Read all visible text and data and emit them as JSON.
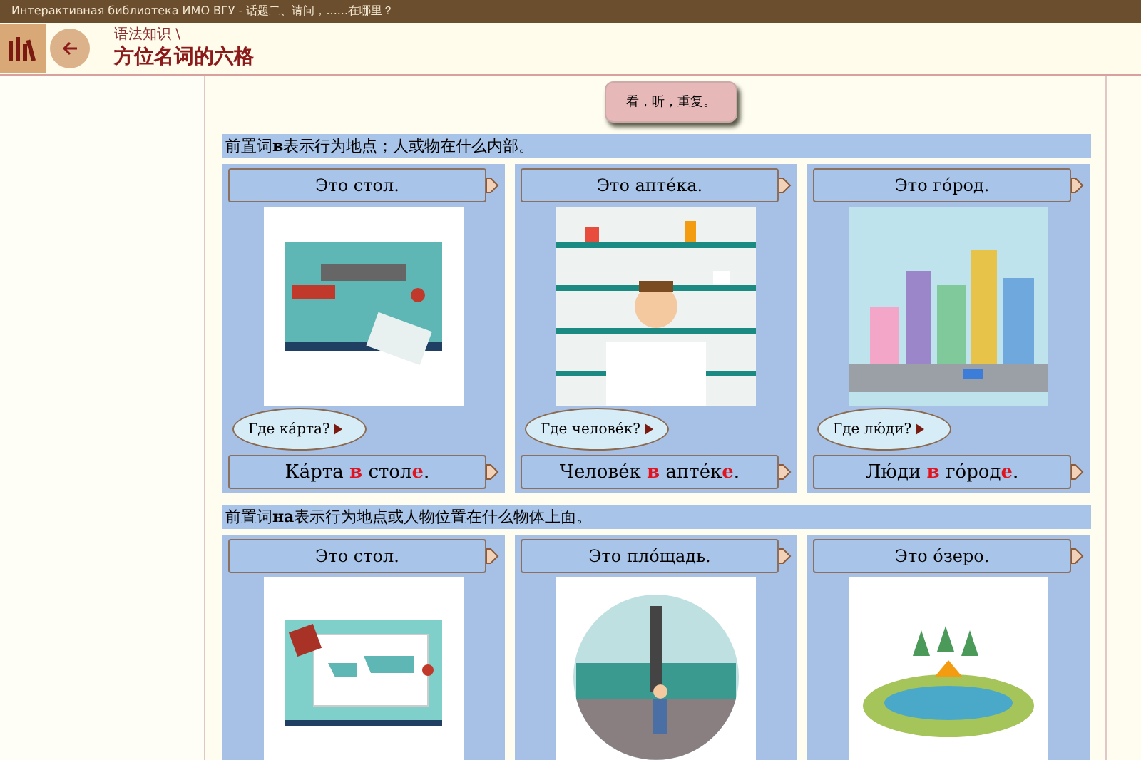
{
  "window": {
    "title": "Интерактивная библиотека ИМО ВГУ  -  话题二、请问，......在哪里？"
  },
  "header": {
    "breadcrumb": "语法知识 \\",
    "title": "方位名词的六格"
  },
  "action_button": "看，听，重复。",
  "sections": [
    {
      "rule": "前置词**в**表示行为地点；人或物在什么内部。",
      "cards": [
        {
          "caption": "Это стол.",
          "kind": "desk",
          "question": "Где ка́рта?",
          "answer": "Ка́рта **в** стол**е**."
        },
        {
          "caption": "Это апте́ка.",
          "kind": "pharmacy",
          "question": "Где челове́к?",
          "answer": "Челове́к **в** апте́к**е**."
        },
        {
          "caption": "Это го́род.",
          "kind": "city",
          "question": "Где лю́ди?",
          "answer": "Лю́ди **в** го́род**е**."
        }
      ]
    },
    {
      "rule": "前置词**на**表示行为地点或人物位置在什么物体上面。",
      "cards": [
        {
          "caption": "Это стол.",
          "kind": "map"
        },
        {
          "caption": "Это пло́щадь.",
          "kind": "square"
        },
        {
          "caption": "Это о́зеро.",
          "kind": "lake"
        }
      ]
    }
  ]
}
